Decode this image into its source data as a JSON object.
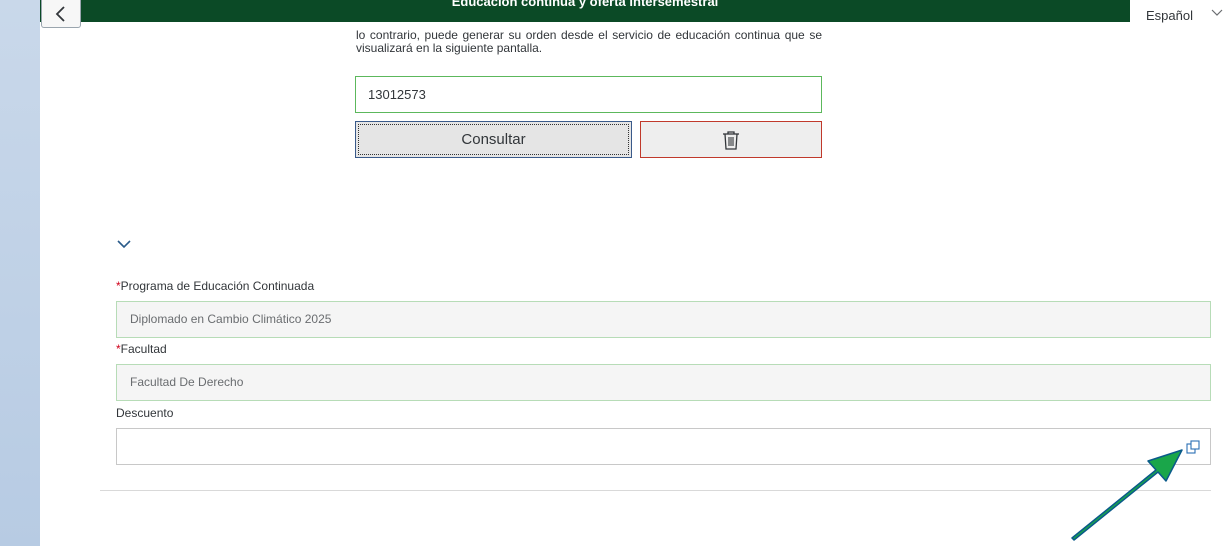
{
  "header": {
    "title": "Educación continua y oferta intersemestral",
    "language": "Español",
    "back_icon": "chevron-left-icon"
  },
  "intro": {
    "text": "lo contrario, puede generar su orden desde el servicio de educación continua que se visualizará en la siguiente pantalla."
  },
  "search": {
    "value": "13012573",
    "consultar_label": "Consultar",
    "delete_icon": "trash-icon"
  },
  "form": {
    "programa": {
      "required_mark": "*",
      "label": "Programa de Educación Continuada",
      "value": "Diplomado en Cambio Climático 2025"
    },
    "facultad": {
      "required_mark": "*",
      "label": "Facultad",
      "value": "Facultad De Derecho"
    },
    "descuento": {
      "label": "Descuento",
      "value": "",
      "icon": "value-help-icon"
    }
  },
  "colors": {
    "header_bg": "#0b4a26",
    "valid_border": "#5cb85c",
    "delete_border": "#c0392b",
    "annotation_arrow": "#1aa64a"
  }
}
